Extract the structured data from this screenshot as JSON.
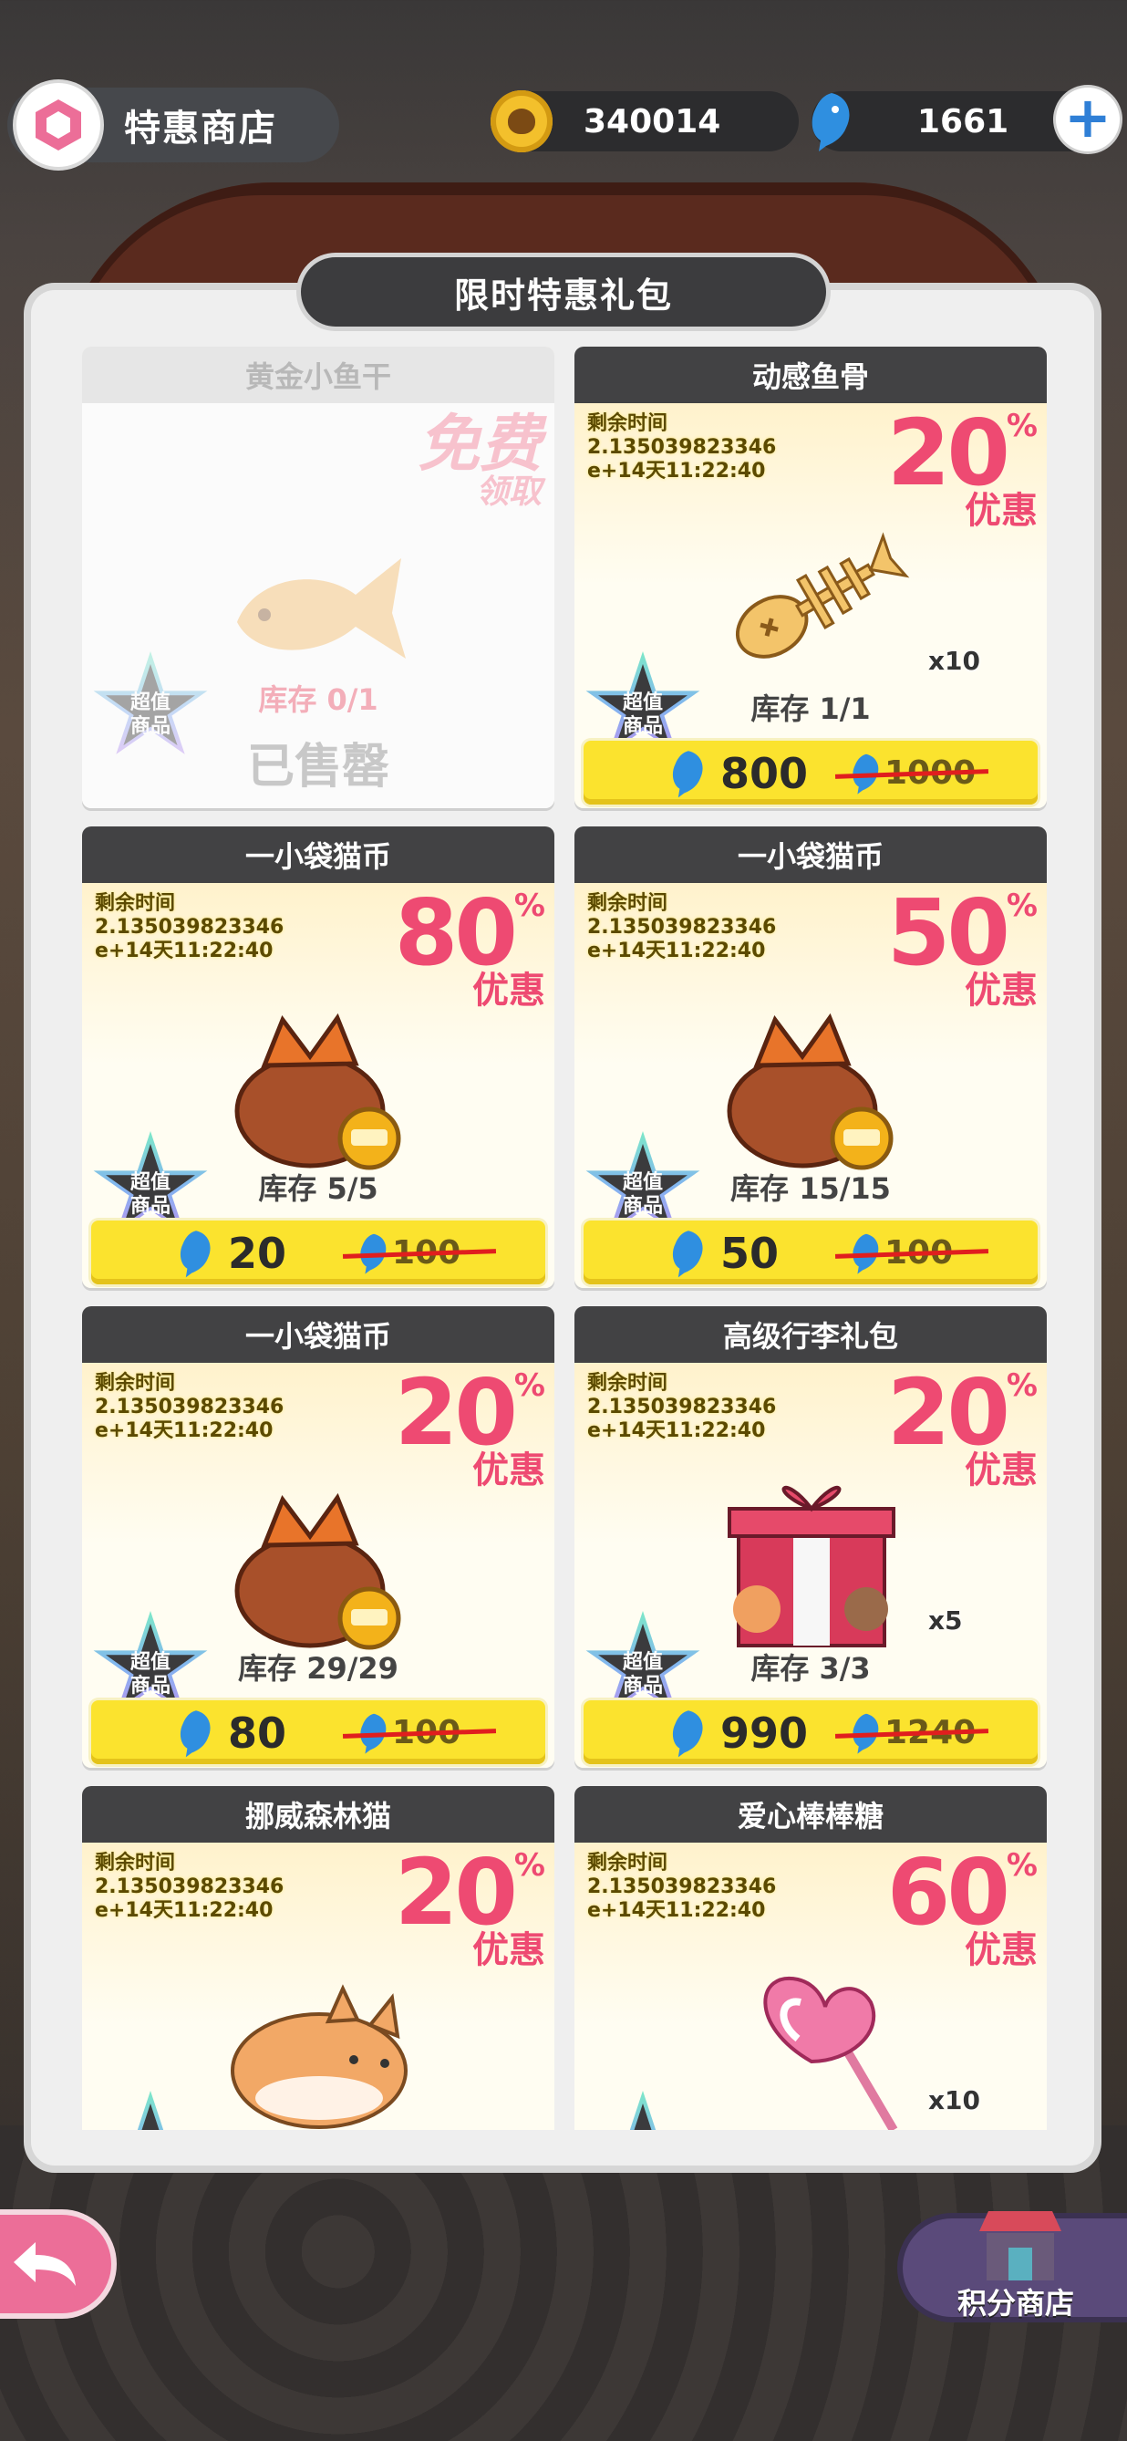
{
  "header": {
    "title": "特惠商店"
  },
  "currency": {
    "coins": "340014",
    "fish": "1661",
    "add_label": "+"
  },
  "panel": {
    "title": "限时特惠礼包"
  },
  "badge": {
    "line1": "超值",
    "line2": "商品"
  },
  "cards": [
    {
      "name": "黄金小鱼干",
      "sold_out": true,
      "free_line1": "免费",
      "free_line2": "领取",
      "stock": "库存 0/1",
      "status": "已售罄",
      "icon": "dried-fish-icon"
    },
    {
      "name": "动感鱼骨",
      "timer_label": "剩余时间",
      "timer_value": "2.135039823346",
      "timer_extra": "e+14天11:22:40",
      "discount": "20",
      "pct": "%",
      "discount_label": "优惠",
      "qty": "x10",
      "stock": "库存 1/1",
      "price": "800",
      "old_price": "1000",
      "icon": "fish-bone-icon"
    },
    {
      "name": "一小袋猫币",
      "timer_label": "剩余时间",
      "timer_value": "2.135039823346",
      "timer_extra": "e+14天11:22:40",
      "discount": "80",
      "pct": "%",
      "discount_label": "优惠",
      "qty": "",
      "stock": "库存 5/5",
      "price": "20",
      "old_price": "100",
      "icon": "coin-bag-icon"
    },
    {
      "name": "一小袋猫币",
      "timer_label": "剩余时间",
      "timer_value": "2.135039823346",
      "timer_extra": "e+14天11:22:40",
      "discount": "50",
      "pct": "%",
      "discount_label": "优惠",
      "qty": "",
      "stock": "库存 15/15",
      "price": "50",
      "old_price": "100",
      "icon": "coin-bag-icon"
    },
    {
      "name": "一小袋猫币",
      "timer_label": "剩余时间",
      "timer_value": "2.135039823346",
      "timer_extra": "e+14天11:22:40",
      "discount": "20",
      "pct": "%",
      "discount_label": "优惠",
      "qty": "",
      "stock": "库存 29/29",
      "price": "80",
      "old_price": "100",
      "icon": "coin-bag-icon"
    },
    {
      "name": "高级行李礼包",
      "timer_label": "剩余时间",
      "timer_value": "2.135039823346",
      "timer_extra": "e+14天11:22:40",
      "discount": "20",
      "pct": "%",
      "discount_label": "优惠",
      "qty": "x5",
      "stock": "库存 3/3",
      "price": "990",
      "old_price": "1240",
      "icon": "gift-box-icon"
    },
    {
      "name": "挪威森林猫",
      "timer_label": "剩余时间",
      "timer_value": "2.135039823346",
      "timer_extra": "e+14天11:22:40",
      "discount": "20",
      "pct": "%",
      "discount_label": "优惠",
      "qty": "",
      "icon": "cat-icon"
    },
    {
      "name": "爱心棒棒糖",
      "timer_label": "剩余时间",
      "timer_value": "2.135039823346",
      "timer_extra": "e+14天11:22:40",
      "discount": "60",
      "pct": "%",
      "discount_label": "优惠",
      "qty": "x10",
      "icon": "heart-lollipop-icon"
    }
  ],
  "footer": {
    "points_shop_label": "积分商店"
  },
  "colors": {
    "accent_pink": "#ee4a72",
    "price_yellow": "#fbe32e",
    "fish_blue": "#2f8fe0",
    "header_dark": "#424244"
  }
}
